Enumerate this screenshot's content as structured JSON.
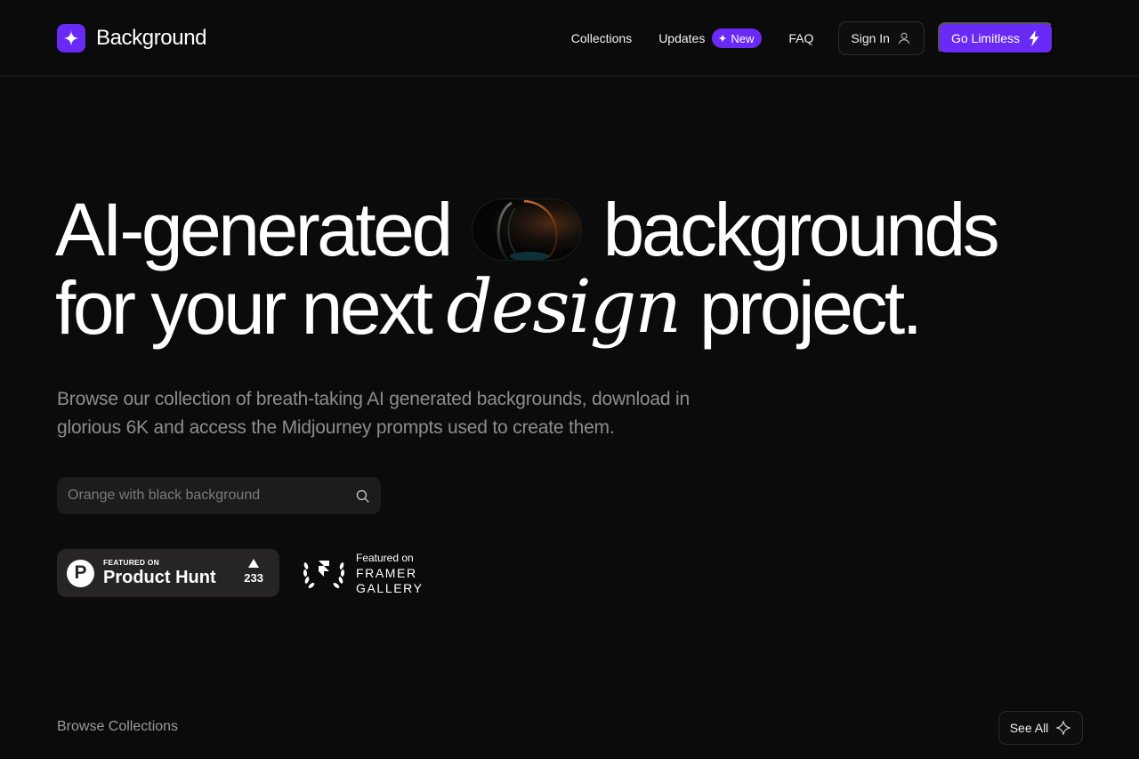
{
  "header": {
    "brand": "Background",
    "nav": {
      "collections": "Collections",
      "updates": "Updates",
      "new_badge": "New",
      "faq": "FAQ"
    },
    "sign_in": "Sign In",
    "cta": "Go Limitless"
  },
  "hero": {
    "line1_a": "AI-generated",
    "line1_b": "backgrounds",
    "line2_a": "for your next",
    "line2_italic": "design",
    "line2_b": "project.",
    "description": "Browse our collection of breath-taking AI generated backgrounds, download in glorious 6K and access the Midjourney prompts used to create them."
  },
  "search": {
    "placeholder": "Orange with black background"
  },
  "product_hunt": {
    "small": "FEATURED ON",
    "title": "Product Hunt",
    "votes": "233"
  },
  "framer": {
    "small": "Featured on",
    "line1": "FRAMER",
    "line2": "GALLERY"
  },
  "collections": {
    "label": "Browse Collections",
    "see_all": "See All"
  },
  "colors": {
    "background": "#0b0b0b",
    "accent": "#6a2af5",
    "muted_text": "#8d8d8d"
  },
  "icons": [
    "sparkle-icon",
    "user-icon",
    "lightning-icon",
    "search-icon",
    "product-hunt-icon",
    "framer-laurel-icon",
    "sparkle-outline-icon"
  ]
}
